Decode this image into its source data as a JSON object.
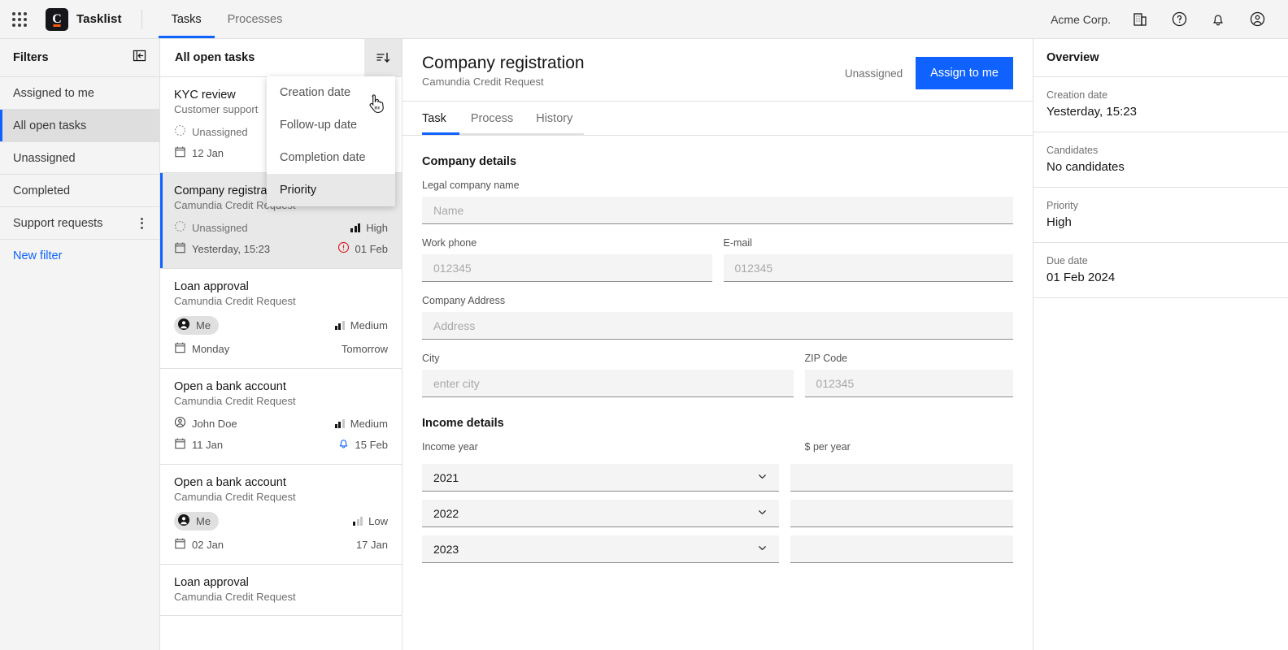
{
  "topbar": {
    "app_grid": "app-grid",
    "brand": "Tasklist",
    "logo_letter": "C",
    "tabs": [
      {
        "label": "Tasks",
        "active": true
      },
      {
        "label": "Processes",
        "active": false
      }
    ],
    "org": "Acme Corp.",
    "icons": [
      "building-icon",
      "help-icon",
      "notifications-icon",
      "account-icon"
    ]
  },
  "filters": {
    "title": "Filters",
    "collapse_icon": "collapse-panel-icon",
    "items": [
      {
        "label": "Assigned to me",
        "selected": false,
        "menu": false
      },
      {
        "label": "All open tasks",
        "selected": true,
        "menu": false
      },
      {
        "label": "Unassigned",
        "selected": false,
        "menu": false
      },
      {
        "label": "Completed",
        "selected": false,
        "menu": false
      },
      {
        "label": "Support requests",
        "selected": false,
        "menu": true
      }
    ],
    "new_filter": "New filter"
  },
  "tasklist": {
    "title": "All open tasks",
    "sort_icon": "sort-descending-icon",
    "tasks": [
      {
        "title": "KYC review",
        "process": "Customer support",
        "assignee": "Unassigned",
        "assignee_type": "unassigned",
        "priority": "",
        "priority_level": 0,
        "created": "12 Jan",
        "due": "",
        "due_type": "none",
        "selected": false
      },
      {
        "title": "Company registration",
        "process": "Camundia Credit Request",
        "assignee": "Unassigned",
        "assignee_type": "unassigned",
        "priority": "High",
        "priority_level": 3,
        "created": "Yesterday, 15:23",
        "due": "01 Feb",
        "due_type": "overdue",
        "selected": true
      },
      {
        "title": "Loan approval",
        "process": "Camundia Credit Request",
        "assignee": "Me",
        "assignee_type": "me",
        "priority": "Medium",
        "priority_level": 2,
        "created": "Monday",
        "due": "Tomorrow",
        "due_type": "plain",
        "selected": false
      },
      {
        "title": "Open a bank account",
        "process": "Camundia Credit Request",
        "assignee": "John Doe",
        "assignee_type": "user",
        "priority": "Medium",
        "priority_level": 2,
        "created": "11 Jan",
        "due": "15 Feb",
        "due_type": "reminder",
        "selected": false
      },
      {
        "title": "Open a bank account",
        "process": "Camundia Credit Request",
        "assignee": "Me",
        "assignee_type": "me",
        "priority": "Low",
        "priority_level": 1,
        "created": "02 Jan",
        "due": "17 Jan",
        "due_type": "plain",
        "selected": false
      },
      {
        "title": "Loan approval",
        "process": "Camundia Credit Request",
        "assignee": "",
        "assignee_type": "none",
        "priority": "",
        "priority_level": 0,
        "created": "",
        "due": "",
        "due_type": "none",
        "selected": false
      }
    ]
  },
  "sort_menu": {
    "open": true,
    "items": [
      {
        "label": "Creation date",
        "hover": false
      },
      {
        "label": "Follow-up date",
        "hover": false
      },
      {
        "label": "Completion date",
        "hover": false
      },
      {
        "label": "Priority",
        "hover": true
      }
    ]
  },
  "detail": {
    "title": "Company registration",
    "subtitle": "Camundia Credit Request",
    "assignee_state": "Unassigned",
    "assign_button": "Assign to me",
    "tabs": [
      {
        "label": "Task",
        "active": true
      },
      {
        "label": "Process",
        "active": false
      },
      {
        "label": "History",
        "active": false
      }
    ],
    "company_section": "Company details",
    "fields": {
      "legal_name": {
        "label": "Legal company name",
        "placeholder": "Name",
        "value": ""
      },
      "work_phone": {
        "label": "Work phone",
        "placeholder": "012345",
        "value": ""
      },
      "email": {
        "label": "E-mail",
        "placeholder": "012345",
        "value": ""
      },
      "address": {
        "label": "Company Address",
        "placeholder": "Address",
        "value": ""
      },
      "city": {
        "label": "City",
        "placeholder": "enter city",
        "value": ""
      },
      "zip": {
        "label": "ZIP Code",
        "placeholder": "012345",
        "value": ""
      }
    },
    "income_section": "Income details",
    "income_year_label": "Income year",
    "income_amount_label": "$ per year",
    "income_rows": [
      {
        "year": "2021",
        "amount": ""
      },
      {
        "year": "2022",
        "amount": ""
      },
      {
        "year": "2023",
        "amount": ""
      }
    ]
  },
  "overview": {
    "title": "Overview",
    "items": [
      {
        "label": "Creation date",
        "value": "Yesterday, 15:23"
      },
      {
        "label": "Candidates",
        "value": "No candidates"
      },
      {
        "label": "Priority",
        "value": "High"
      },
      {
        "label": "Due date",
        "value": "01 Feb 2024"
      }
    ]
  },
  "colors": {
    "accent": "#0f62fe",
    "brand_orange": "#fc5d0d",
    "overdue_red": "#da1e28",
    "reminder_blue": "#0f62fe",
    "selected_bg": "#e8e8e8",
    "panel_bg": "#f4f4f4"
  }
}
